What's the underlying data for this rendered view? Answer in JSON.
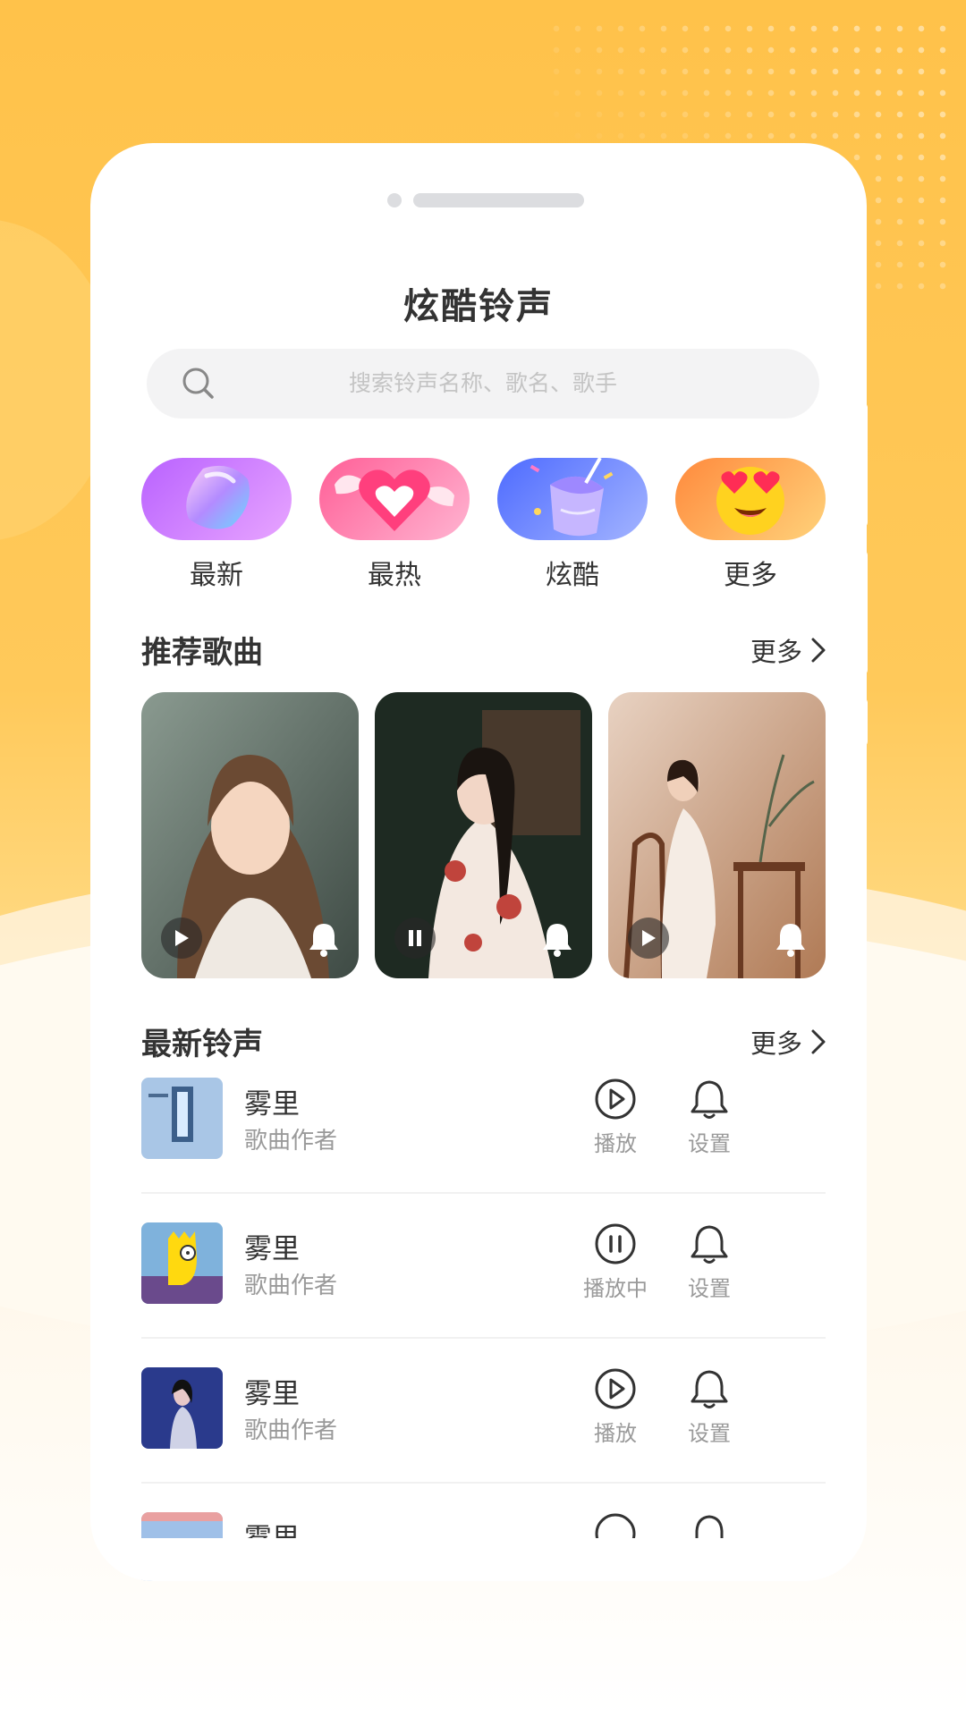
{
  "app": {
    "title": "炫酷铃声"
  },
  "search": {
    "placeholder": "搜索铃声名称、歌名、歌手",
    "icon": "search-icon"
  },
  "categories": [
    {
      "label": "最新",
      "icon": "gem-icon",
      "color_from": "#c77bff",
      "color_to": "#e6a6ff"
    },
    {
      "label": "最热",
      "icon": "winged-heart-icon",
      "color_from": "#ff6d9e",
      "color_to": "#ffb3cf"
    },
    {
      "label": "炫酷",
      "icon": "party-cup-icon",
      "color_from": "#5f7bff",
      "color_to": "#a7b7ff"
    },
    {
      "label": "更多",
      "icon": "heart-eyes-emoji-icon",
      "color_from": "#ff8a3d",
      "color_to": "#ffcf7a"
    }
  ],
  "recommended": {
    "heading": "推荐歌曲",
    "more_label": "更多",
    "items": [
      {
        "state": "paused",
        "control_icon": "play-icon",
        "bell_icon": "bell-icon"
      },
      {
        "state": "playing",
        "control_icon": "pause-icon",
        "bell_icon": "bell-icon"
      },
      {
        "state": "paused",
        "control_icon": "play-icon",
        "bell_icon": "bell-icon"
      }
    ]
  },
  "latest": {
    "heading": "最新铃声",
    "more_label": "更多",
    "rows": [
      {
        "name": "雾里",
        "artist": "歌曲作者",
        "play_label": "播放",
        "play_icon": "play-circle-icon",
        "set_label": "设置"
      },
      {
        "name": "雾里",
        "artist": "歌曲作者",
        "play_label": "播放中",
        "play_icon": "pause-circle-icon",
        "set_label": "设置"
      },
      {
        "name": "雾里",
        "artist": "歌曲作者",
        "play_label": "播放",
        "play_icon": "play-circle-icon",
        "set_label": "设置"
      },
      {
        "name": "雾里",
        "artist": "",
        "play_label": "",
        "play_icon": "play-circle-icon",
        "set_label": ""
      }
    ]
  },
  "colors": {
    "background_top": "#ffc24a",
    "text_primary": "#333333",
    "text_secondary": "#9a9a9a",
    "search_bg": "#f3f3f4"
  }
}
